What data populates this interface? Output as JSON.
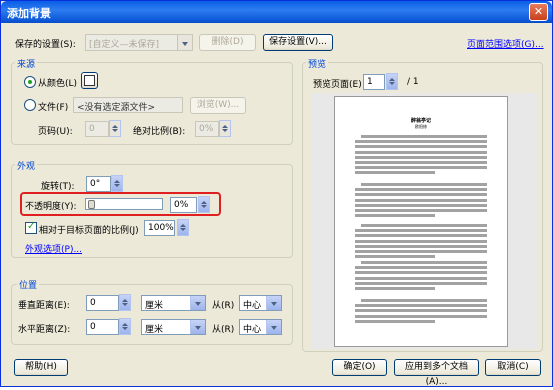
{
  "window": {
    "title": "添加背景",
    "close": "✕"
  },
  "top": {
    "saved_label": "保存的设置(S):",
    "saved_value": "[自定义—未保存]",
    "delete_btn": "删除(D)",
    "save_btn": "保存设置(V)...",
    "page_range_link": "页面范围选项(G)..."
  },
  "source": {
    "group_label": "来源",
    "from_color": "从颜色(L)",
    "color_hex": "#ffffff",
    "from_file": "文件(F)",
    "file_value": "<没有选定源文件>",
    "browse_btn": "浏览(W)...",
    "page_label": "页码(U):",
    "page_value": "0",
    "abs_scale_label": "绝对比例(B):",
    "abs_scale_value": "0%"
  },
  "appearance": {
    "group_label": "外观",
    "rotation_label": "旋转(T):",
    "rotation_value": "0°",
    "opacity_label": "不透明度(Y):",
    "opacity_value": "0%",
    "relative_scale_label": "相对于目标页面的比例(J)",
    "relative_scale_value": "100%",
    "appearance_options_link": "外观选项(P)..."
  },
  "position": {
    "group_label": "位置",
    "vertical_label": "垂直距离(E):",
    "vertical_value": "0",
    "vertical_unit": "厘米",
    "vertical_from_label": "从(R)",
    "vertical_from_value": "中心",
    "horizontal_label": "水平距离(Z):",
    "horizontal_value": "0",
    "horizontal_unit": "厘米",
    "horizontal_from_label": "从(R)",
    "horizontal_from_value": "中心"
  },
  "preview": {
    "group_label": "预览",
    "page_label": "预览页面(E)",
    "page_value": "1",
    "page_total": "/ 1",
    "doc_title": "醉翁亭记",
    "doc_author": "欧阳修"
  },
  "footer": {
    "help_btn": "帮助(H)",
    "ok_btn": "确定(O)",
    "apply_multi_btn": "应用到多个文档(A)...",
    "cancel_btn": "取消(C)"
  },
  "colors": {
    "title_bar": "#0a5ee6",
    "dialog_bg": "#ece9d8",
    "highlight": "#e02020",
    "link": "#0000ff"
  }
}
